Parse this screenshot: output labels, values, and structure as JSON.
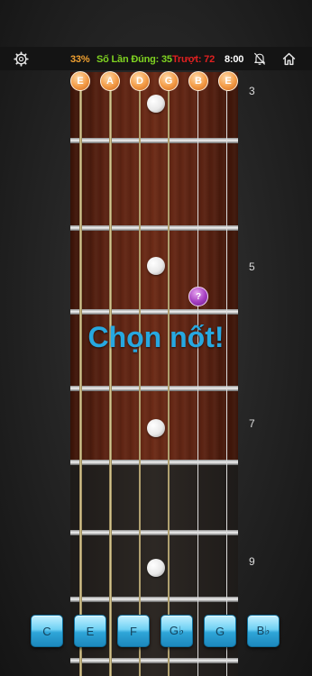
{
  "header": {
    "progress_percent": "33%",
    "correct_label": "Số Lần Đúng: 35",
    "wrong_label": "Trượt: 72",
    "timer": "8:00"
  },
  "icons": {
    "settings": "gear-icon",
    "sound": "muted-bell-icon",
    "home": "home-icon"
  },
  "strings": [
    "E",
    "A",
    "D",
    "G",
    "B",
    "E"
  ],
  "fret_numbers": [
    "3",
    "5",
    "7",
    "9"
  ],
  "question_marker": "?",
  "prompt": "Chọn nốt!",
  "answers": [
    "C",
    "E",
    "F",
    "G♭",
    "G",
    "B♭"
  ],
  "colors": {
    "progress": "#f0a030",
    "correct": "#7fd321",
    "wrong": "#e02020",
    "prompt": "#27a8e0",
    "marker": "#a43cc0",
    "answer_button": "#4cc0ec"
  }
}
